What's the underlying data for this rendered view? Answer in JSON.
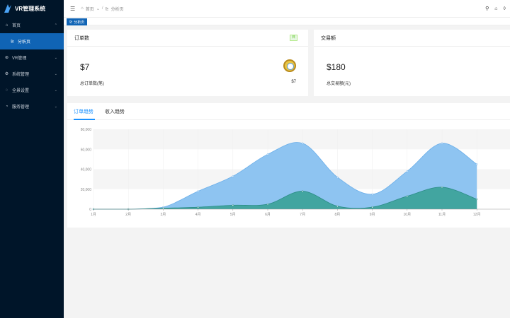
{
  "app": {
    "title": "VR管理系统"
  },
  "sidebar": {
    "items": [
      {
        "label": "首页",
        "icon": "home-icon"
      },
      {
        "label": "分析页",
        "icon": "chart-icon"
      },
      {
        "label": "VR管理",
        "icon": "vr-icon"
      },
      {
        "label": "系统管理",
        "icon": "gear-icon"
      },
      {
        "label": "全景设置",
        "icon": "panorama-icon"
      },
      {
        "label": "服务管理",
        "icon": "service-icon"
      }
    ]
  },
  "header": {
    "breadcrumb": [
      "首页",
      "分析页"
    ]
  },
  "tabs": {
    "active": "分析页"
  },
  "cards": {
    "order": {
      "title": "订单数",
      "badge": "日",
      "value": "$7",
      "sub_label": "总订单数(笔)",
      "sub_value": "$7"
    },
    "trade": {
      "title": "交易额",
      "value": "$180",
      "sub_label": "总交易额(元)"
    }
  },
  "chart_tabs": [
    "订单趋势",
    "收入趋势"
  ],
  "colors": {
    "sidebar": "#001529",
    "primary": "#1064b5",
    "area_blue": "#8ec4f1",
    "area_teal": "#3ea39b"
  },
  "chart_data": {
    "type": "area",
    "categories": [
      "1月",
      "2月",
      "3月",
      "4月",
      "5月",
      "6月",
      "7月",
      "8月",
      "9月",
      "10月",
      "11月",
      "12月"
    ],
    "series": [
      {
        "values": [
          0,
          0,
          2000,
          18000,
          33000,
          55000,
          66000,
          32000,
          15000,
          38000,
          66000,
          45000
        ]
      },
      {
        "values": [
          0,
          0,
          1000,
          2000,
          4000,
          5000,
          18000,
          3000,
          2000,
          13000,
          22000,
          10000
        ]
      }
    ],
    "ylim": [
      0,
      80000
    ],
    "yticks": [
      "0",
      "20,000",
      "40,000",
      "60,000",
      "80,000"
    ],
    "grid": true
  }
}
